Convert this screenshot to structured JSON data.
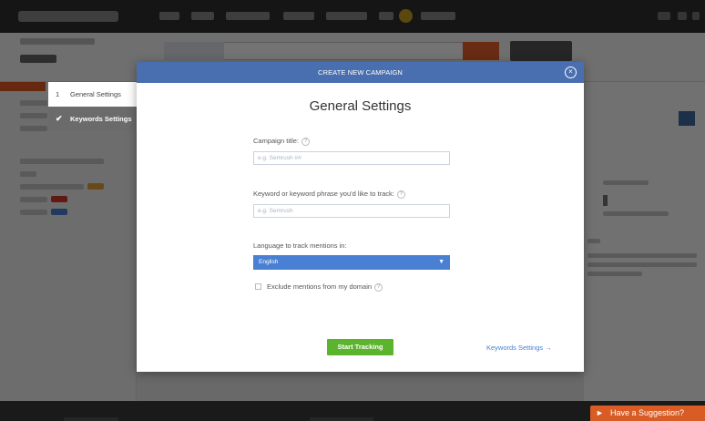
{
  "modal": {
    "header": "CREATE NEW CAMPAIGN",
    "title": "General Settings",
    "fields": {
      "campaign_title_label": "Campaign title:",
      "campaign_title_placeholder": "e.g. Semrush ##",
      "keyword_label": "Keyword or keyword phrase you'd like to track:",
      "keyword_placeholder": "e.g. Semrush",
      "language_label": "Language to track mentions in:",
      "language_value": "English",
      "exclude_label": "Exclude mentions from my domain"
    },
    "start_button": "Start Tracking",
    "next_link": "Keywords Settings →"
  },
  "steps": {
    "step1_number": "1",
    "step1_label": "General Settings",
    "step2_label": "Keywords Settings"
  },
  "footer": {
    "suggestion": "Have a Suggestion?"
  },
  "colors": {
    "modal_header": "#4a6fb0",
    "select": "#4a80d4",
    "start_button": "#5bb32e",
    "suggestion": "#d85c24",
    "topnav": "#2f2f2f"
  },
  "icons": {
    "close": "close-icon",
    "help": "help-icon",
    "check": "check-icon",
    "chevron": "chevron-down-icon"
  }
}
